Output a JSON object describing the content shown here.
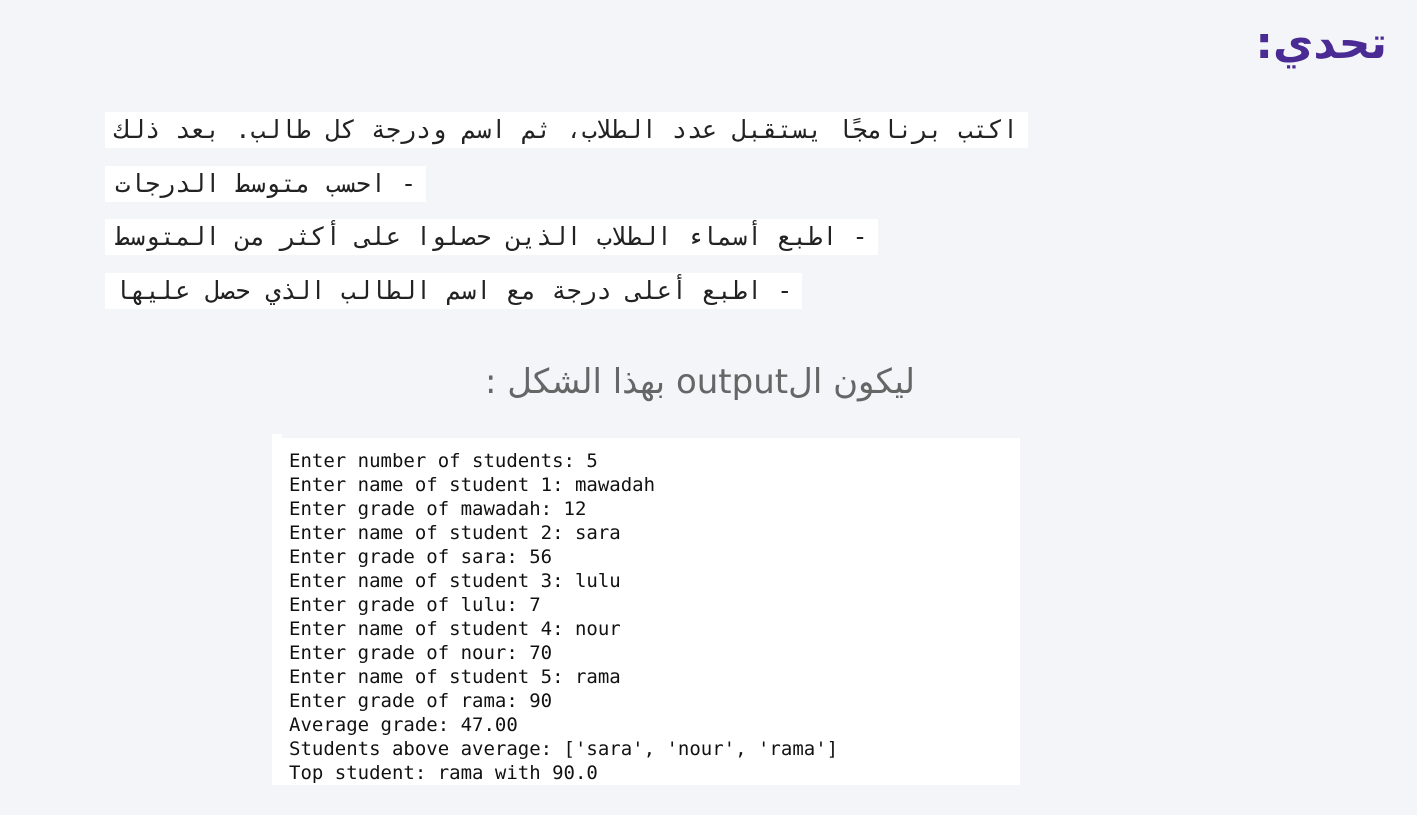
{
  "header": {
    "title": "تحدي:"
  },
  "task": {
    "lines": [
      "اكتب برنامجًا يستقبل عدد الطلاب، ثم اسم ودرجة كل طالب. بعد ذلك",
      "- احسب متوسط الدرجات",
      "- اطبع أسماء الطلاب الذين حصلوا على أكثر من المتوسط",
      "- اطبع أعلى درجة مع اسم الطالب الذي حصل عليها"
    ]
  },
  "output_label": "ليكون الoutput بهذا الشكل :",
  "console": {
    "lines": [
      "Enter number of students: 5",
      "Enter name of student 1: mawadah",
      "Enter grade of mawadah: 12",
      "Enter name of student 2: sara",
      "Enter grade of sara: 56",
      "Enter name of student 3: lulu",
      "Enter grade of lulu: 7",
      "Enter name of student 4: nour",
      "Enter grade of nour: 70",
      "Enter name of student 5: rama",
      "Enter grade of rama: 90",
      "Average grade: 47.00",
      "Students above average: ['sara', 'nour', 'rama']",
      "Top student: rama with 90.0"
    ]
  },
  "colors": {
    "title": "#4a2a93",
    "background": "#f4f5f9",
    "console_background": "#ffffff"
  }
}
